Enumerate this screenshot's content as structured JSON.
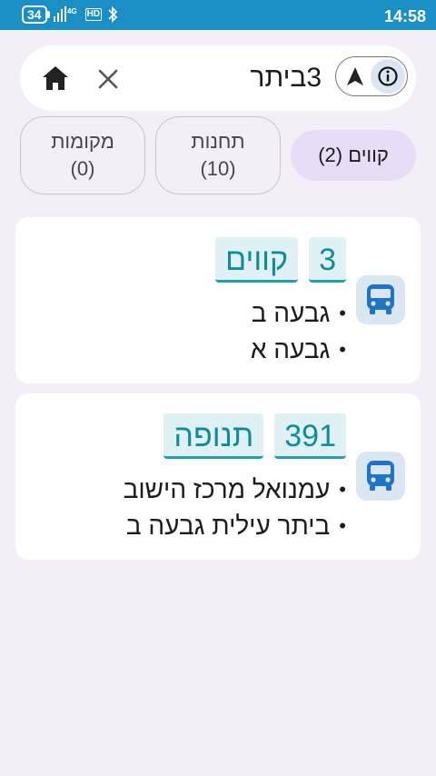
{
  "status_bar": {
    "battery": "34",
    "network": "4G",
    "hd": "HD",
    "time": "14:58"
  },
  "search": {
    "query": "3ביתר",
    "home_icon": "home-icon",
    "clear_icon": "close-icon",
    "navigate_icon": "navigation-arrow-icon",
    "info_icon": "info-icon"
  },
  "filters": [
    {
      "label": "קווים",
      "count": "(2)",
      "selected": true
    },
    {
      "label": "תחנות",
      "count": "(10)",
      "selected": false
    },
    {
      "label": "מקומות",
      "count": "(0)",
      "selected": false
    }
  ],
  "results": [
    {
      "line": "3",
      "operator": "קווים",
      "stops": [
        "גבעה ב",
        "גבעה א"
      ],
      "icon": "bus-icon"
    },
    {
      "line": "391",
      "operator": "תנופה",
      "stops": [
        "עמנואל מרכז הישוב",
        "ביתר עילית גבעה ב"
      ],
      "icon": "bus-icon"
    }
  ],
  "colors": {
    "status_bar": "#1a8fc5",
    "background": "#f3eff8",
    "chip_selected": "#e8ddf7",
    "tag_bg": "#dff1f4",
    "tag_text": "#0d8d99",
    "bus_icon": "#1f74c6"
  }
}
